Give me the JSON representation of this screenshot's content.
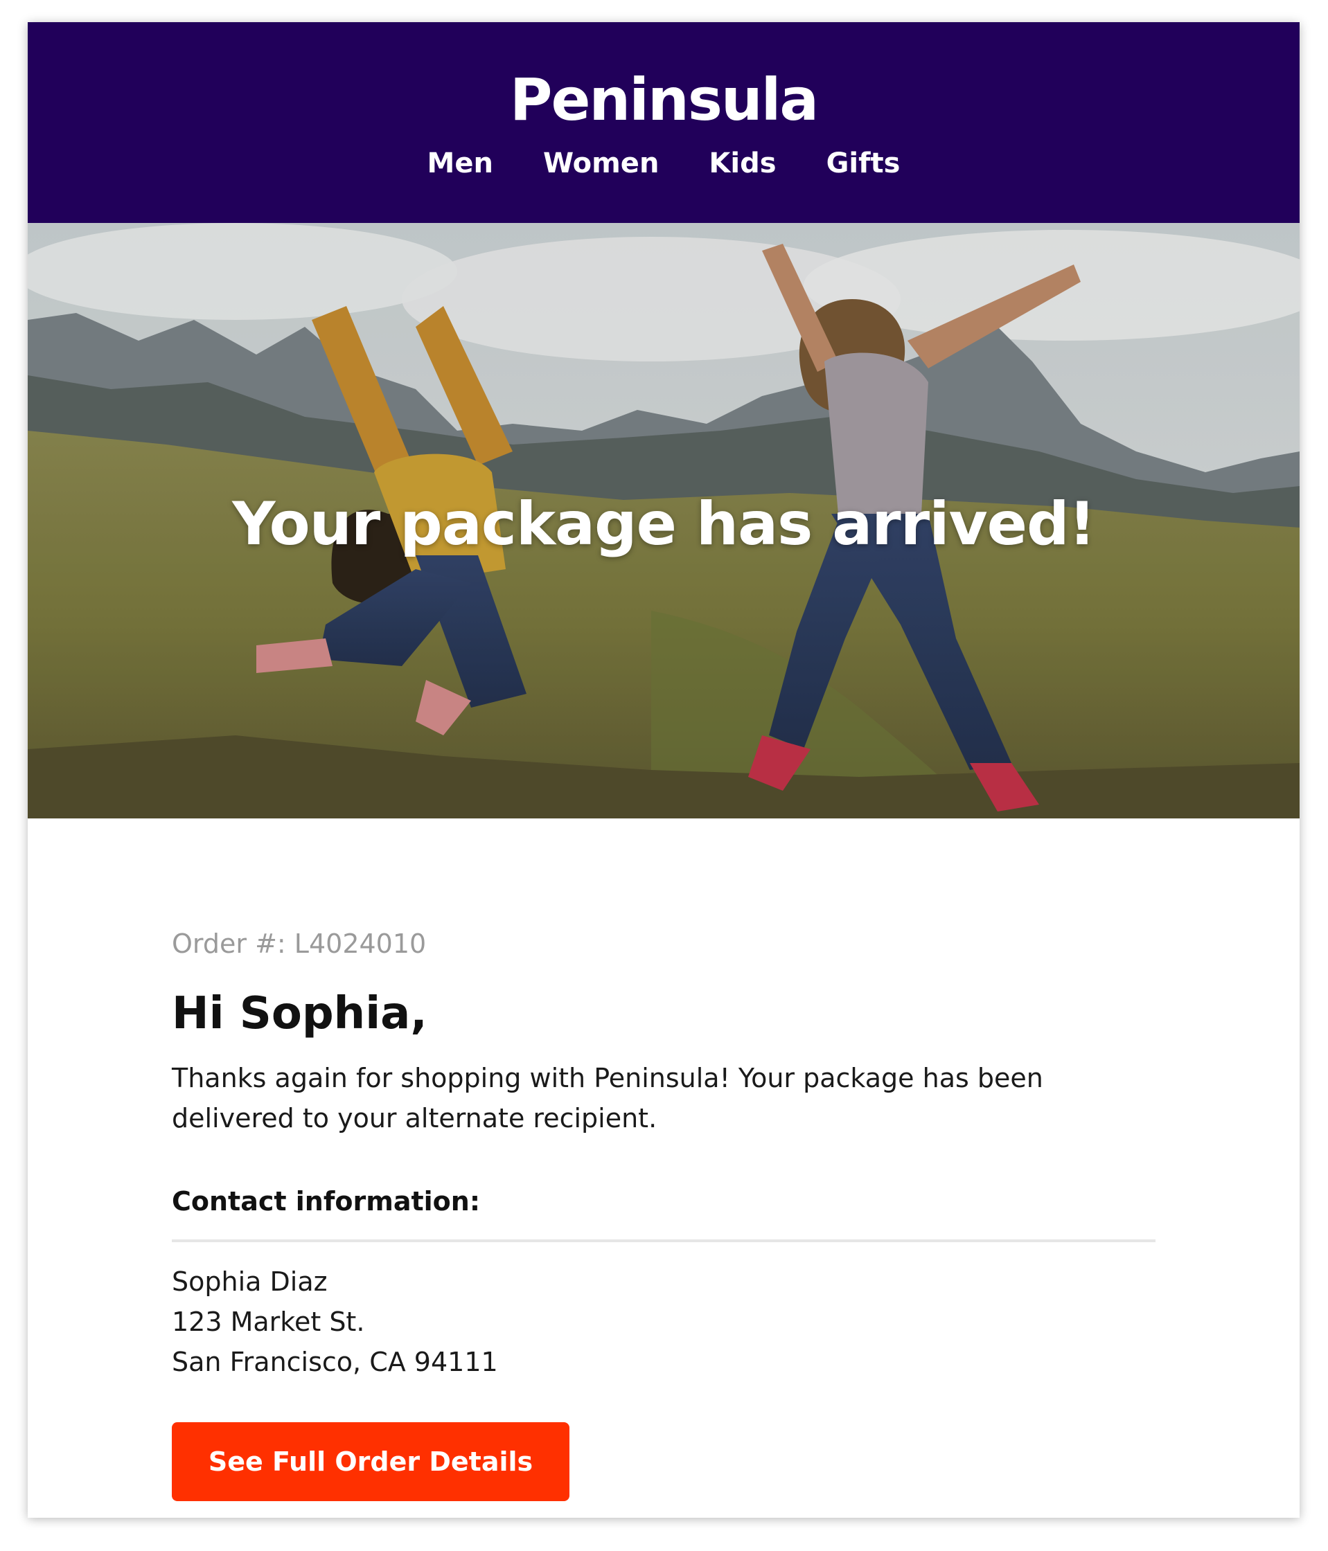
{
  "brand": {
    "name": "Peninsula",
    "color": "#21005a"
  },
  "nav": {
    "items": [
      {
        "label": "Men"
      },
      {
        "label": "Women"
      },
      {
        "label": "Kids"
      },
      {
        "label": "Gifts"
      }
    ]
  },
  "hero": {
    "title": "Your package has arrived!"
  },
  "order": {
    "number_label": "Order #: L4024010"
  },
  "greeting": "Hi Sophia,",
  "message": "Thanks again for shopping with Peninsula! Your package has been delivered to your alternate recipient.",
  "contact": {
    "heading": "Contact information:",
    "name": "Sophia Diaz",
    "street": "123 Market St.",
    "city_line": "San Francisco, CA 94111"
  },
  "cta": {
    "label": "See Full Order Details",
    "color": "#ff3000"
  }
}
